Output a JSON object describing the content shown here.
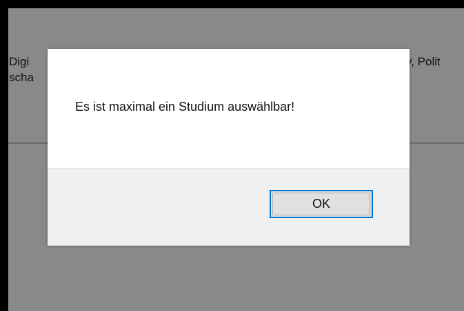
{
  "background": {
    "left_text_line1": "Digi",
    "left_text_line2": "scha",
    "right_text_line1": "y, Polit"
  },
  "dialog": {
    "message": "Es ist maximal ein Studium auswählbar!",
    "ok_label": "OK"
  },
  "colors": {
    "overlay": "#898989",
    "dialog_bg": "#ffffff",
    "footer_bg": "#f0f0f0",
    "button_focus_border": "#0078d7",
    "button_bg": "#e1e1e1"
  }
}
